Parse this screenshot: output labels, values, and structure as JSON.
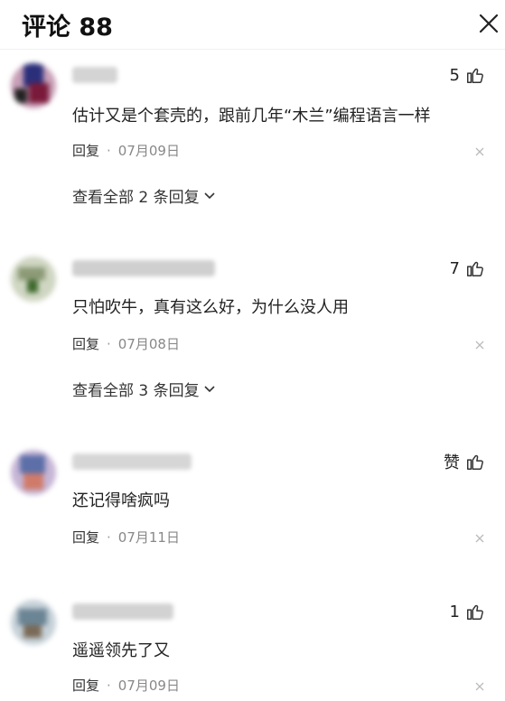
{
  "header": {
    "title": "评论 88"
  },
  "comments": [
    {
      "likes": "5",
      "text": "估计又是个套壳的，跟前几年“木兰”编程语言一样",
      "reply_label": "回复",
      "separator": "·",
      "date": "07月09日",
      "more_replies": "查看全部 2 条回复"
    },
    {
      "likes": "7",
      "text": "只怕吹牛，真有这么好，为什么没人用",
      "reply_label": "回复",
      "separator": "·",
      "date": "07月08日",
      "more_replies": "查看全部 3 条回复"
    },
    {
      "likes": "赞",
      "text": "还记得啥疯吗",
      "reply_label": "回复",
      "separator": "·",
      "date": "07月11日"
    },
    {
      "likes": "1",
      "text": "遥遥领先了又",
      "reply_label": "回复",
      "separator": "·",
      "date": "07月09日"
    }
  ]
}
